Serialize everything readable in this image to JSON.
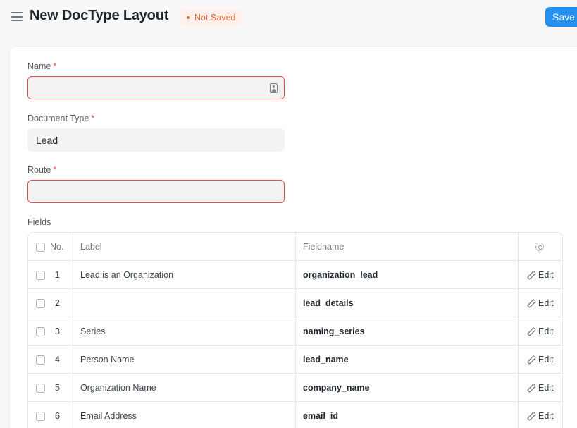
{
  "header": {
    "title": "New DocType Layout",
    "status": "Not Saved",
    "save_label": "Save"
  },
  "form": {
    "name": {
      "label": "Name",
      "required": "*",
      "value": ""
    },
    "document_type": {
      "label": "Document Type",
      "required": "*",
      "value": "Lead"
    },
    "route": {
      "label": "Route",
      "required": "*",
      "value": ""
    }
  },
  "fields_table": {
    "title": "Fields",
    "columns": {
      "no": "No.",
      "label": "Label",
      "fieldname": "Fieldname"
    },
    "edit_label": "Edit",
    "rows": [
      {
        "no": "1",
        "label": "Lead is an Organization",
        "fieldname": "organization_lead"
      },
      {
        "no": "2",
        "label": "",
        "fieldname": "lead_details"
      },
      {
        "no": "3",
        "label": "Series",
        "fieldname": "naming_series"
      },
      {
        "no": "4",
        "label": "Person Name",
        "fieldname": "lead_name"
      },
      {
        "no": "5",
        "label": "Organization Name",
        "fieldname": "company_name"
      },
      {
        "no": "6",
        "label": "Email Address",
        "fieldname": "email_id"
      }
    ]
  },
  "icons": {
    "menu": "hamburger-icon",
    "contact": "contact-card-icon",
    "settings": "gear-icon",
    "edit": "pencil-icon"
  },
  "colors": {
    "accent": "#2490ef",
    "error": "#e24c4c",
    "status": "#e86c3a"
  }
}
